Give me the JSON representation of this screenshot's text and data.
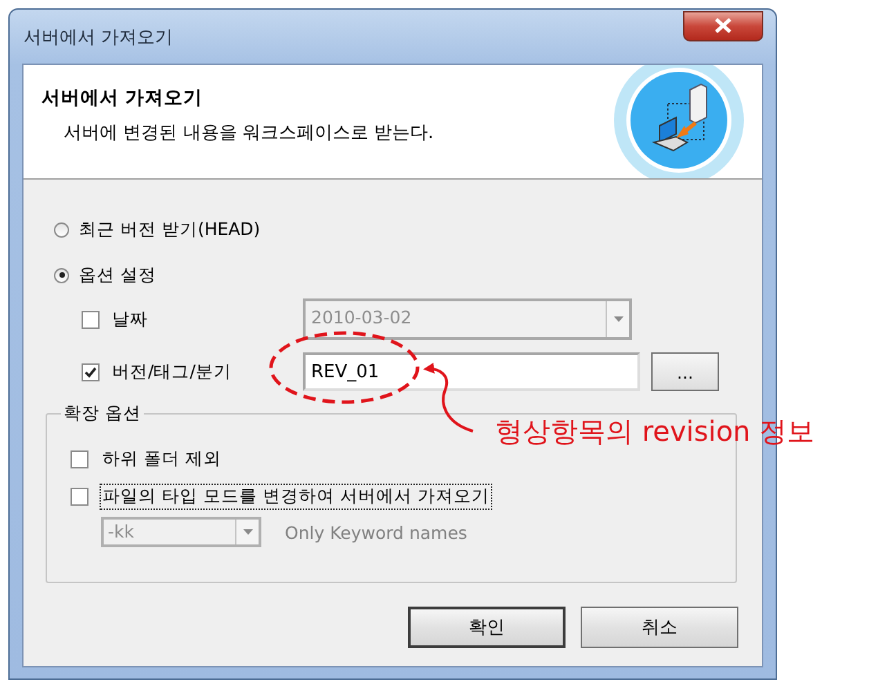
{
  "window": {
    "title": "서버에서 가져오기"
  },
  "header": {
    "title": "서버에서 가져오기",
    "subtitle": "서버에 변경된 내용을 워크스페이스로 받는다."
  },
  "options": [
    {
      "label": "최근 버전 받기(HEAD)",
      "selected": false
    },
    {
      "label": "옵션 설정",
      "selected": true
    }
  ],
  "date": {
    "label": "날짜",
    "checked": false,
    "value": "2010-03-02",
    "disabled": true
  },
  "version": {
    "label": "버전/태그/분기",
    "checked": true,
    "value": "REV_01",
    "browse_button": "..."
  },
  "extended_options": {
    "title": "확장 옵션",
    "items": [
      {
        "label": "하위 폴더 제외",
        "checked": false,
        "focused": false
      },
      {
        "label": "파일의 타입 모드를 변경하여 서버에서 가져오기",
        "checked": false,
        "focused": true
      }
    ],
    "keyword_mode": {
      "value": "-kk",
      "disabled": true
    },
    "keyword_note": "Only Keyword names"
  },
  "buttons": [
    "확인",
    "취소"
  ],
  "annotation": {
    "text": "형상항목의 revision 정보"
  }
}
